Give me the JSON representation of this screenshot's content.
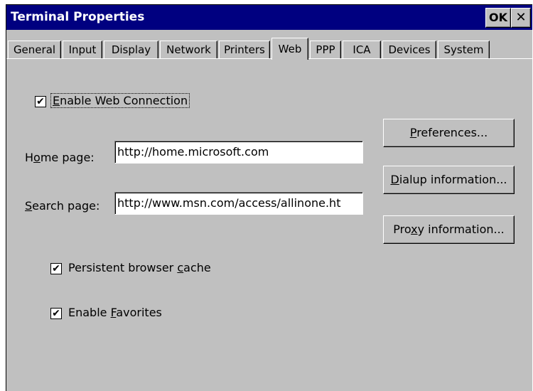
{
  "window": {
    "title": "Terminal Properties",
    "ok_label": "OK",
    "close_label": "✕"
  },
  "tabs": [
    {
      "label": "General"
    },
    {
      "label": "Input"
    },
    {
      "label": "Display"
    },
    {
      "label": "Network"
    },
    {
      "label": "Printers"
    },
    {
      "label": "Web",
      "active": true
    },
    {
      "label": "PPP"
    },
    {
      "label": "ICA"
    },
    {
      "label": "Devices"
    },
    {
      "label": "System"
    }
  ],
  "web": {
    "enable_web_connection": {
      "pre": "",
      "accel": "E",
      "post": "nable Web Connection",
      "checked": true
    },
    "home_page": {
      "pre": "H",
      "accel": "o",
      "post": "me page:",
      "value": "http://home.microsoft.com"
    },
    "search_page": {
      "pre": "",
      "accel": "S",
      "post": "earch page:",
      "value": "http://www.msn.com/access/allinone.ht"
    },
    "persistent_cache": {
      "pre": "Persistent browser ",
      "accel": "c",
      "post": "ache",
      "checked": true
    },
    "enable_favorites": {
      "pre": "Enable ",
      "accel": "F",
      "post": "avorites",
      "checked": true
    },
    "check_glyph": "✔"
  },
  "buttons": {
    "preferences": {
      "pre": "",
      "accel": "P",
      "post": "references..."
    },
    "dialup": {
      "pre": "",
      "accel": "D",
      "post": "ialup information..."
    },
    "proxy": {
      "pre": "Pro",
      "accel": "x",
      "post": "y information..."
    }
  }
}
